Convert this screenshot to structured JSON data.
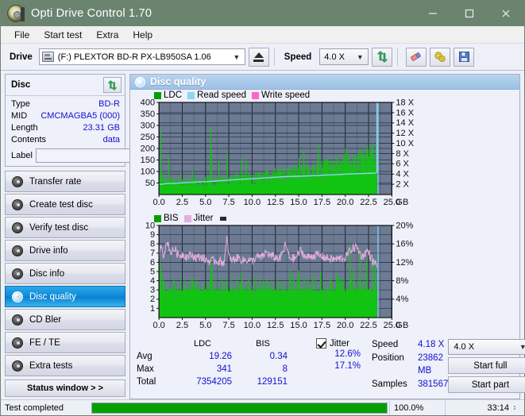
{
  "window": {
    "title": "Opti Drive Control 1.70",
    "icon": "disc-drive-icon",
    "minimize": "minimize-icon",
    "maximize": "maximize-icon",
    "close": "close-icon",
    "titlebar_color": "#6b8470"
  },
  "menu": {
    "items": [
      {
        "label": "File"
      },
      {
        "label": "Start test"
      },
      {
        "label": "Extra"
      },
      {
        "label": "Help"
      }
    ]
  },
  "toolbar": {
    "drive_label": "Drive",
    "drive_value": "(F:)  PLEXTOR BD-R  PX-LB950SA 1.06",
    "eject_icon": "eject-icon",
    "speed_label": "Speed",
    "speed_value": "4.0 X",
    "refresh_icon": "refresh-icon",
    "erase_icon": "eraser-icon",
    "settings_icon": "gears-icon",
    "save_icon": "save-floppy-icon"
  },
  "sidebar": {
    "disc_panel": {
      "title": "Disc",
      "refresh_icon": "refresh-green-arrows-icon",
      "rows": [
        {
          "key": "Type",
          "value": "BD-R"
        },
        {
          "key": "MID",
          "value": "CMCMAGBA5 (000)"
        },
        {
          "key": "Length",
          "value": "23.31 GB"
        },
        {
          "key": "Contents",
          "value": "data"
        }
      ],
      "label_key": "Label",
      "label_value": "",
      "label_placeholder": "",
      "label_button_icon": "disc-icon"
    },
    "nav": [
      {
        "label": "Transfer rate",
        "icon": "disc-icon",
        "active": false
      },
      {
        "label": "Create test disc",
        "icon": "disc-icon",
        "active": false
      },
      {
        "label": "Verify test disc",
        "icon": "disc-icon",
        "active": false
      },
      {
        "label": "Drive info",
        "icon": "disc-icon",
        "active": false
      },
      {
        "label": "Disc info",
        "icon": "disc-icon",
        "active": false
      },
      {
        "label": "Disc quality",
        "icon": "disc-icon",
        "active": true
      },
      {
        "label": "CD Bler",
        "icon": "disc-icon",
        "active": false
      },
      {
        "label": "FE / TE",
        "icon": "disc-icon",
        "active": false
      },
      {
        "label": "Extra tests",
        "icon": "disc-icon",
        "active": false
      }
    ],
    "status_window_button": "Status window > >"
  },
  "main": {
    "header_title": "Disc quality",
    "header_icon": "disc-quality-icon"
  },
  "stats": {
    "col_headers": [
      "LDC",
      "BIS"
    ],
    "rows": [
      {
        "key": "Avg",
        "ldc": "19.26",
        "bis": "0.34"
      },
      {
        "key": "Max",
        "ldc": "341",
        "bis": "8"
      },
      {
        "key": "Total",
        "ldc": "7354205",
        "bis": "129151"
      }
    ],
    "jitter": {
      "checkbox_checked": true,
      "label": "Jitter",
      "avg": "12.6%",
      "max": "17.1%"
    },
    "measures": [
      {
        "key": "Speed",
        "value": "4.18 X"
      },
      {
        "key": "Position",
        "value": "23862 MB"
      },
      {
        "key": "Samples",
        "value": "381567"
      }
    ],
    "speed_select": "4.0 X",
    "start_full_button": "Start full",
    "start_part_button": "Start part"
  },
  "statusbar": {
    "message": "Test completed",
    "progress_percent": 100.0,
    "progress_text": "100.0%",
    "elapsed": "33:14"
  },
  "chart_data": [
    {
      "id": "ldc-chart",
      "type": "line",
      "title": "",
      "xlabel": "GB",
      "ylabel": "",
      "xlim": [
        0,
        25
      ],
      "xticks": [
        "0.0",
        "2.5",
        "5.0",
        "7.5",
        "10.0",
        "12.5",
        "15.0",
        "17.5",
        "20.0",
        "22.5",
        "25.0"
      ],
      "xtick_values": [
        0,
        2.5,
        5,
        7.5,
        10,
        12.5,
        15,
        17.5,
        20,
        22.5,
        25
      ],
      "x_unit_label": "GB",
      "ylim": [
        0,
        400
      ],
      "yticks": [
        50,
        100,
        150,
        200,
        250,
        300,
        350,
        400
      ],
      "y2lim": [
        0,
        18
      ],
      "y2ticks": [
        "2 X",
        "4 X",
        "6 X",
        "8 X",
        "10 X",
        "12 X",
        "14 X",
        "16 X",
        "18 X"
      ],
      "y2tick_values": [
        2,
        4,
        6,
        8,
        10,
        12,
        14,
        16,
        18
      ],
      "grid": true,
      "plot_bg": "#6c7b93",
      "legend_position": "top-left",
      "legend": [
        {
          "name": "LDC",
          "color": "#00a000"
        },
        {
          "name": "Read speed",
          "color": "#8ed4f5"
        },
        {
          "name": "Write speed",
          "color": "#ff66cc"
        }
      ],
      "series": [
        {
          "name": "LDC",
          "color": "#13c413",
          "type": "spike-area",
          "note": "dense green band with baseline ~20-40 and frequent spikes",
          "baseline": [
            38,
            34,
            32,
            33,
            31,
            30,
            31,
            30,
            29,
            30,
            31,
            30,
            30,
            31,
            31,
            32,
            33,
            32,
            33,
            34,
            34,
            35,
            35,
            34,
            35,
            36,
            36,
            35,
            36,
            37,
            37,
            38,
            38,
            39,
            39,
            40,
            40,
            41,
            41,
            42,
            42,
            43,
            43,
            44,
            44,
            45,
            46,
            46,
            47,
            47,
            48,
            49,
            49,
            50,
            51,
            52,
            52,
            53,
            54,
            55,
            56,
            57,
            58,
            58,
            59,
            60,
            61,
            62,
            63,
            64,
            65,
            66,
            67,
            68,
            69,
            70,
            71,
            72,
            73,
            74,
            75,
            77,
            78,
            79,
            80,
            82,
            83,
            84,
            86,
            87,
            89,
            90,
            92,
            93,
            95,
            96,
            98,
            100,
            102,
            104
          ],
          "spikes": [
            {
              "x": 0.18,
              "y": 280
            },
            {
              "x": 0.35,
              "y": 95
            },
            {
              "x": 1.05,
              "y": 160
            },
            {
              "x": 1.55,
              "y": 70
            },
            {
              "x": 2.35,
              "y": 90
            },
            {
              "x": 2.9,
              "y": 55
            },
            {
              "x": 3.6,
              "y": 105
            },
            {
              "x": 4.45,
              "y": 60
            },
            {
              "x": 5.55,
              "y": 285
            },
            {
              "x": 5.62,
              "y": 185
            },
            {
              "x": 6.4,
              "y": 150
            },
            {
              "x": 7.35,
              "y": 178
            },
            {
              "x": 8.3,
              "y": 92
            },
            {
              "x": 8.85,
              "y": 158
            },
            {
              "x": 9.35,
              "y": 150
            },
            {
              "x": 10.1,
              "y": 80
            },
            {
              "x": 11.4,
              "y": 70
            },
            {
              "x": 12.45,
              "y": 115
            },
            {
              "x": 13.15,
              "y": 95
            },
            {
              "x": 14.05,
              "y": 90
            },
            {
              "x": 15.05,
              "y": 160
            },
            {
              "x": 15.55,
              "y": 195
            },
            {
              "x": 15.95,
              "y": 120
            },
            {
              "x": 16.35,
              "y": 95
            },
            {
              "x": 17.1,
              "y": 215
            },
            {
              "x": 17.5,
              "y": 110
            },
            {
              "x": 18.5,
              "y": 145
            },
            {
              "x": 19.45,
              "y": 110
            },
            {
              "x": 20.05,
              "y": 200
            },
            {
              "x": 20.45,
              "y": 120
            },
            {
              "x": 21.0,
              "y": 165
            },
            {
              "x": 21.45,
              "y": 185
            },
            {
              "x": 22.0,
              "y": 155
            },
            {
              "x": 22.45,
              "y": 125
            },
            {
              "x": 22.85,
              "y": 150
            }
          ]
        },
        {
          "name": "Read speed",
          "color": "#8ed4f5",
          "type": "step",
          "axis": "right",
          "points": [
            {
              "x": 0.0,
              "y": 2.0
            },
            {
              "x": 0.3,
              "y": 2.0
            },
            {
              "x": 0.6,
              "y": 2.1
            },
            {
              "x": 1.2,
              "y": 2.15
            },
            {
              "x": 2.0,
              "y": 2.2
            },
            {
              "x": 2.6,
              "y": 2.3
            },
            {
              "x": 3.4,
              "y": 2.35
            },
            {
              "x": 4.2,
              "y": 2.45
            },
            {
              "x": 5.0,
              "y": 2.5
            },
            {
              "x": 5.8,
              "y": 2.6
            },
            {
              "x": 6.6,
              "y": 2.7
            },
            {
              "x": 7.4,
              "y": 2.8
            },
            {
              "x": 8.2,
              "y": 2.9
            },
            {
              "x": 9.0,
              "y": 3.0
            },
            {
              "x": 9.8,
              "y": 3.05
            },
            {
              "x": 10.6,
              "y": 3.15
            },
            {
              "x": 11.4,
              "y": 3.25
            },
            {
              "x": 12.2,
              "y": 3.35
            },
            {
              "x": 13.0,
              "y": 3.45
            },
            {
              "x": 13.8,
              "y": 3.5
            },
            {
              "x": 14.6,
              "y": 3.55
            },
            {
              "x": 15.4,
              "y": 3.6
            },
            {
              "x": 16.2,
              "y": 3.65
            },
            {
              "x": 17.0,
              "y": 3.7
            },
            {
              "x": 17.8,
              "y": 3.8
            },
            {
              "x": 18.6,
              "y": 3.85
            },
            {
              "x": 19.4,
              "y": 3.9
            },
            {
              "x": 20.2,
              "y": 4.0
            },
            {
              "x": 21.0,
              "y": 4.05
            },
            {
              "x": 21.8,
              "y": 4.1
            },
            {
              "x": 22.6,
              "y": 4.15
            },
            {
              "x": 23.3,
              "y": 4.2
            }
          ],
          "end_vertical": {
            "x": 23.4,
            "y_from": 4.2,
            "y_to": 18.0
          }
        }
      ]
    },
    {
      "id": "bis-jitter-chart",
      "type": "line",
      "title": "",
      "xlabel": "GB",
      "ylabel": "",
      "xlim": [
        0,
        25
      ],
      "xticks": [
        "0.0",
        "2.5",
        "5.0",
        "7.5",
        "10.0",
        "12.5",
        "15.0",
        "17.5",
        "20.0",
        "22.5",
        "25.0"
      ],
      "xtick_values": [
        0,
        2.5,
        5,
        7.5,
        10,
        12.5,
        15,
        17.5,
        20,
        22.5,
        25
      ],
      "x_unit_label": "GB",
      "ylim": [
        0,
        10
      ],
      "yticks": [
        1,
        2,
        3,
        4,
        5,
        6,
        7,
        8,
        9,
        10
      ],
      "y2lim": [
        0,
        20
      ],
      "y2ticks": [
        "4%",
        "8%",
        "12%",
        "16%",
        "20%"
      ],
      "y2tick_values": [
        4,
        8,
        12,
        16,
        20
      ],
      "grid": true,
      "plot_bg": "#6c7b93",
      "legend_position": "top-left",
      "legend": [
        {
          "name": "BIS",
          "color": "#00a000"
        },
        {
          "name": "Jitter",
          "color": "#e2aede"
        }
      ],
      "series": [
        {
          "name": "BIS",
          "color": "#13c413",
          "type": "spike-area",
          "note": "solid green band baseline ~2, dense narrow spikes to 3-5, occasional to 8",
          "baseline_level": 2.0,
          "spike_common_top": 3.0,
          "spikes": [
            {
              "x": 0.12,
              "y": 6.0
            },
            {
              "x": 0.2,
              "y": 5.0
            },
            {
              "x": 0.45,
              "y": 4.2
            },
            {
              "x": 1.6,
              "y": 4.0
            },
            {
              "x": 3.6,
              "y": 3.9
            },
            {
              "x": 5.6,
              "y": 6.0
            },
            {
              "x": 5.68,
              "y": 5.5
            },
            {
              "x": 8.9,
              "y": 5.0
            },
            {
              "x": 9.6,
              "y": 4.2
            },
            {
              "x": 11.6,
              "y": 4.1
            },
            {
              "x": 12.1,
              "y": 4.0
            },
            {
              "x": 14.1,
              "y": 5.2
            },
            {
              "x": 15.0,
              "y": 5.1
            },
            {
              "x": 15.6,
              "y": 4.4
            },
            {
              "x": 16.5,
              "y": 4.6
            },
            {
              "x": 17.4,
              "y": 5.0
            },
            {
              "x": 18.4,
              "y": 4.4
            },
            {
              "x": 19.1,
              "y": 4.8
            },
            {
              "x": 20.5,
              "y": 8.0
            },
            {
              "x": 20.9,
              "y": 5.2
            },
            {
              "x": 21.6,
              "y": 7.4
            },
            {
              "x": 22.3,
              "y": 6.2
            },
            {
              "x": 22.9,
              "y": 6.6
            },
            {
              "x": 23.2,
              "y": 5.6
            }
          ]
        },
        {
          "name": "Jitter",
          "color": "#e2aede",
          "axis": "right",
          "type": "noisy-line",
          "note": "noisy trace oscillating around 12-14%, dipping to ~11.5% mid, peaks to ~17%",
          "mean_percent": 12.6,
          "max_percent": 17.1,
          "points": [
            {
              "x": 0.0,
              "y": 12.0
            },
            {
              "x": 0.2,
              "y": 16.2
            },
            {
              "x": 0.5,
              "y": 13.6
            },
            {
              "x": 0.9,
              "y": 16.5
            },
            {
              "x": 1.3,
              "y": 14.0
            },
            {
              "x": 1.7,
              "y": 15.0
            },
            {
              "x": 2.1,
              "y": 13.4
            },
            {
              "x": 2.6,
              "y": 13.8
            },
            {
              "x": 3.0,
              "y": 13.2
            },
            {
              "x": 3.5,
              "y": 13.6
            },
            {
              "x": 4.0,
              "y": 13.0
            },
            {
              "x": 4.5,
              "y": 13.2
            },
            {
              "x": 5.0,
              "y": 12.6
            },
            {
              "x": 5.5,
              "y": 12.2
            },
            {
              "x": 6.0,
              "y": 12.4
            },
            {
              "x": 6.5,
              "y": 12.2
            },
            {
              "x": 7.0,
              "y": 12.0
            },
            {
              "x": 7.3,
              "y": 17.1
            },
            {
              "x": 7.6,
              "y": 12.4
            },
            {
              "x": 8.0,
              "y": 12.6
            },
            {
              "x": 8.5,
              "y": 13.0
            },
            {
              "x": 9.0,
              "y": 12.4
            },
            {
              "x": 9.5,
              "y": 12.6
            },
            {
              "x": 10.0,
              "y": 12.2
            },
            {
              "x": 10.5,
              "y": 13.2
            },
            {
              "x": 11.0,
              "y": 13.0
            },
            {
              "x": 11.5,
              "y": 14.2
            },
            {
              "x": 12.0,
              "y": 13.4
            },
            {
              "x": 12.5,
              "y": 13.0
            },
            {
              "x": 13.0,
              "y": 12.8
            },
            {
              "x": 13.6,
              "y": 15.8
            },
            {
              "x": 14.0,
              "y": 13.0
            },
            {
              "x": 14.6,
              "y": 12.8
            },
            {
              "x": 15.2,
              "y": 14.6
            },
            {
              "x": 15.8,
              "y": 13.0
            },
            {
              "x": 16.4,
              "y": 13.4
            },
            {
              "x": 17.0,
              "y": 13.6
            },
            {
              "x": 17.6,
              "y": 13.2
            },
            {
              "x": 18.2,
              "y": 12.8
            },
            {
              "x": 18.8,
              "y": 12.6
            },
            {
              "x": 19.4,
              "y": 12.8
            },
            {
              "x": 20.0,
              "y": 13.0
            },
            {
              "x": 20.6,
              "y": 14.8
            },
            {
              "x": 21.2,
              "y": 15.4
            },
            {
              "x": 21.8,
              "y": 13.2
            },
            {
              "x": 22.4,
              "y": 14.6
            },
            {
              "x": 23.0,
              "y": 12.0
            },
            {
              "x": 23.3,
              "y": 11.6
            }
          ]
        }
      ]
    }
  ]
}
